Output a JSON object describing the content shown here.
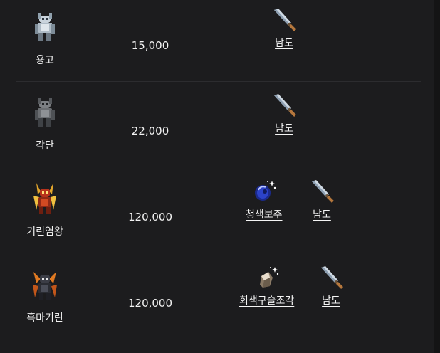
{
  "rows": [
    {
      "name": "용고",
      "price": "15,000",
      "drops": [
        {
          "name": "남도",
          "icon": "sword-icon"
        }
      ]
    },
    {
      "name": "각단",
      "price": "22,000",
      "drops": [
        {
          "name": "남도",
          "icon": "sword-icon"
        }
      ]
    },
    {
      "name": "기린염왕",
      "price": "120,000",
      "drops": [
        {
          "name": "청색보주",
          "icon": "blue-orb-icon"
        },
        {
          "name": "남도",
          "icon": "sword-icon"
        }
      ]
    },
    {
      "name": "흑마기린",
      "price": "120,000",
      "drops": [
        {
          "name": "회색구슬조각",
          "icon": "grey-shard-icon"
        },
        {
          "name": "남도",
          "icon": "sword-icon"
        }
      ]
    }
  ],
  "colors": {
    "background": "#1c1c1e",
    "divider": "#2c2c2f",
    "text": "#ececec"
  }
}
